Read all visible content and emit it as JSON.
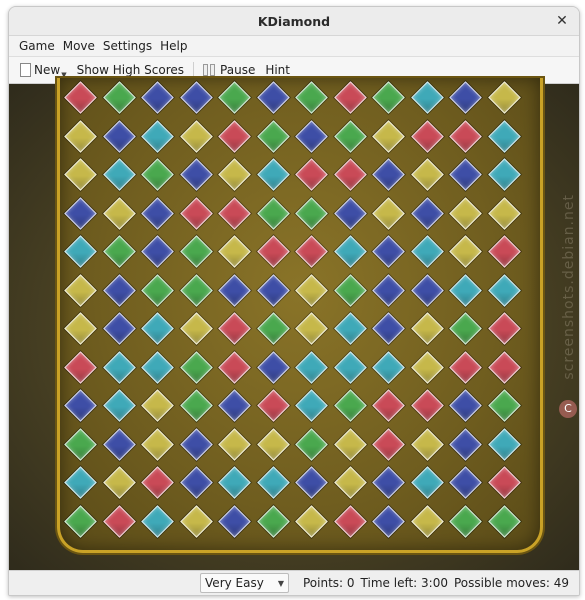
{
  "window": {
    "title": "KDiamond"
  },
  "menubar": {
    "items": [
      {
        "label": "Game"
      },
      {
        "label": "Move"
      },
      {
        "label": "Settings"
      },
      {
        "label": "Help"
      }
    ]
  },
  "toolbar": {
    "new_label": "New",
    "high_scores_label": "Show High Scores",
    "pause_label": "Pause",
    "hint_label": "Hint"
  },
  "watermark": {
    "text": "screenshots.debian.net"
  },
  "colors": {
    "r": "#c94a57",
    "g": "#4aa84e",
    "b": "#3e4ea6",
    "c": "#3fa9b8",
    "y": "#c6b84a",
    "frame": "#c9a227"
  },
  "board": {
    "rows": [
      "rgbbgbgrgcby",
      "ybcyrgbgyrrc",
      "ycgbycrrbybc",
      "bybrrggbybyy",
      "cgbgyrrcbcyr",
      "ybggbbygbbcc",
      "ybcyrgycbygr",
      "rccgrbcccyrr",
      "bcygbrcgrrbg",
      "gbybyygyrybc",
      "cyrbccbybcbr",
      "grcybgyrbygg"
    ]
  },
  "status": {
    "difficulty": "Very Easy",
    "points": "Points: 0",
    "time_left": "Time left: 3:00",
    "possible_moves": "Possible moves: 49"
  }
}
